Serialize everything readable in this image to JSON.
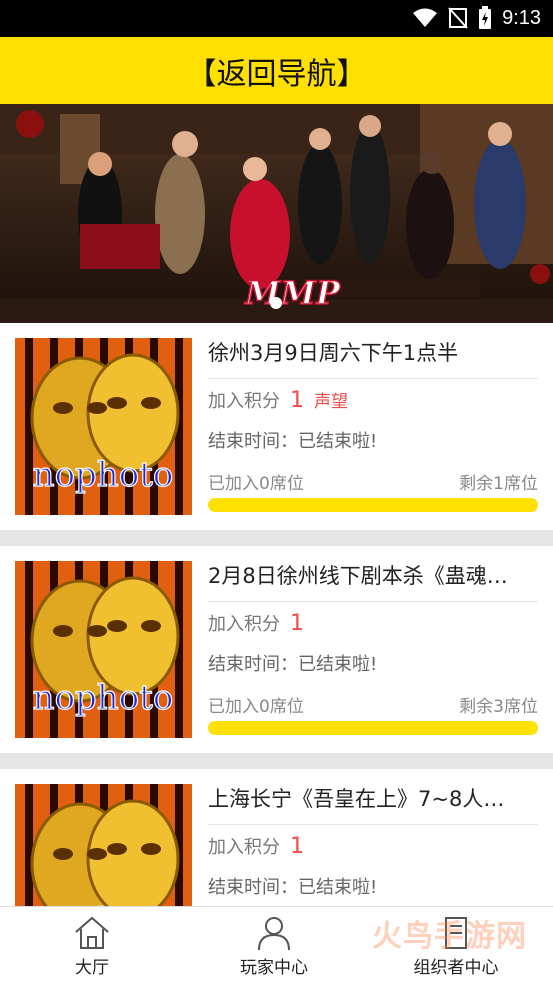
{
  "status": {
    "time": "9:13"
  },
  "header": {
    "title": "【返回导航】"
  },
  "banner": {
    "logo_text": "MMP",
    "slide_count": 1,
    "active_slide": 0
  },
  "events": [
    {
      "title": "徐州3月9日周六下午1点半",
      "thumb_text": "nophoto",
      "points_label": "加入积分",
      "points_value": "1",
      "points_unit": "声望",
      "end_label": "结束时间：已结束啦!",
      "joined": "已加入0席位",
      "remaining": "剩余1席位",
      "fill_fraction": 1.0
    },
    {
      "title": "2月8日徐州线下剧本杀《蛊魂…",
      "thumb_text": "nophoto",
      "points_label": "加入积分",
      "points_value": "1",
      "points_unit": "",
      "end_label": "结束时间：已结束啦!",
      "joined": "已加入0席位",
      "remaining": "剩余3席位",
      "fill_fraction": 1.0
    },
    {
      "title": "上海长宁《吾皇在上》7~8人…",
      "thumb_text": "nophoto",
      "points_label": "加入积分",
      "points_value": "1",
      "points_unit": "",
      "end_label": "结束时间：已结束啦!",
      "joined": "",
      "remaining": "",
      "fill_fraction": 1.0
    }
  ],
  "tabs": [
    {
      "label": "大厅",
      "icon": "home-icon"
    },
    {
      "label": "玩家中心",
      "icon": "person-icon"
    },
    {
      "label": "组织者中心",
      "icon": "document-icon"
    }
  ],
  "watermark": "火鸟手游网",
  "colors": {
    "accent": "#ffe000",
    "points": "#f04a4a"
  }
}
